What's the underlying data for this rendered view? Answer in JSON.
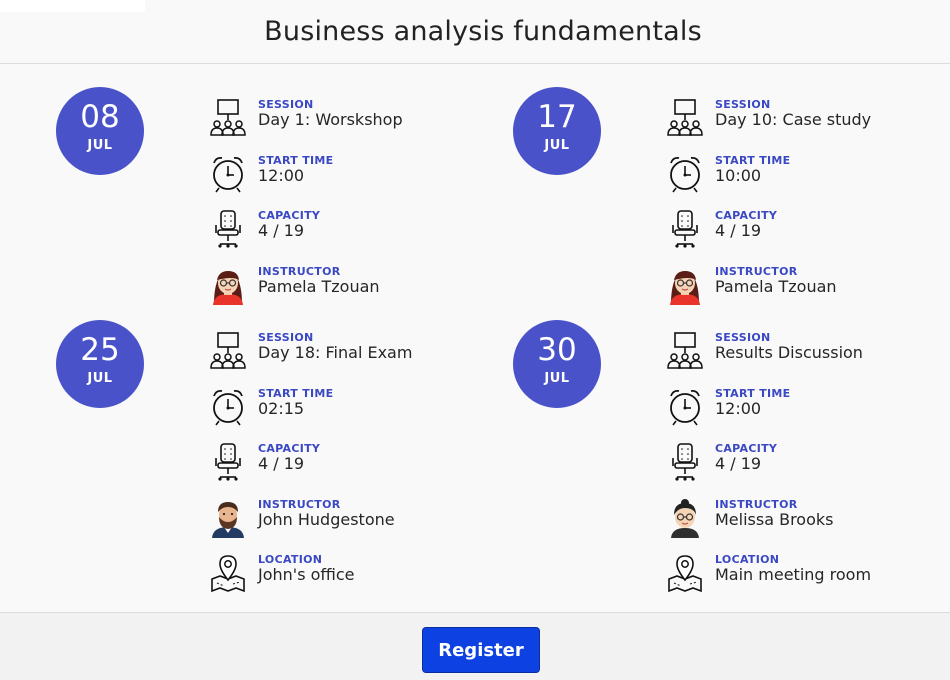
{
  "page": {
    "title": "Business analysis fundamentals"
  },
  "labels": {
    "session": "SESSION",
    "start_time": "START TIME",
    "capacity": "CAPACITY",
    "instructor": "INSTRUCTOR",
    "location": "LOCATION"
  },
  "sessions": [
    {
      "day": "08",
      "month": "JUL",
      "session": "Day 1: Worskshop",
      "start_time": "12:00",
      "capacity": "4 / 19",
      "instructor": "Pamela Tzouan",
      "location": ""
    },
    {
      "day": "17",
      "month": "JUL",
      "session": "Day 10: Case study",
      "start_time": "10:00",
      "capacity": "4 / 19",
      "instructor": "Pamela Tzouan",
      "location": ""
    },
    {
      "day": "25",
      "month": "JUL",
      "session": "Day 18: Final Exam",
      "start_time": "02:15",
      "capacity": "4 / 19",
      "instructor": "John Hudgestone",
      "location": "John's office"
    },
    {
      "day": "30",
      "month": "JUL",
      "session": "Results Discussion",
      "start_time": "12:00",
      "capacity": "4 / 19",
      "instructor": "Melissa Brooks",
      "location": "Main meeting room"
    }
  ],
  "footer": {
    "register_label": "Register"
  },
  "colors": {
    "accent": "#4a52c9",
    "label": "#3a48c4",
    "button": "#0d41e1"
  },
  "icons": [
    "presentation-icon",
    "alarm-clock-icon",
    "office-chair-icon",
    "avatar-woman-red-hair-icon",
    "avatar-man-beard-icon",
    "avatar-woman-dark-hair-icon",
    "map-pin-icon"
  ]
}
